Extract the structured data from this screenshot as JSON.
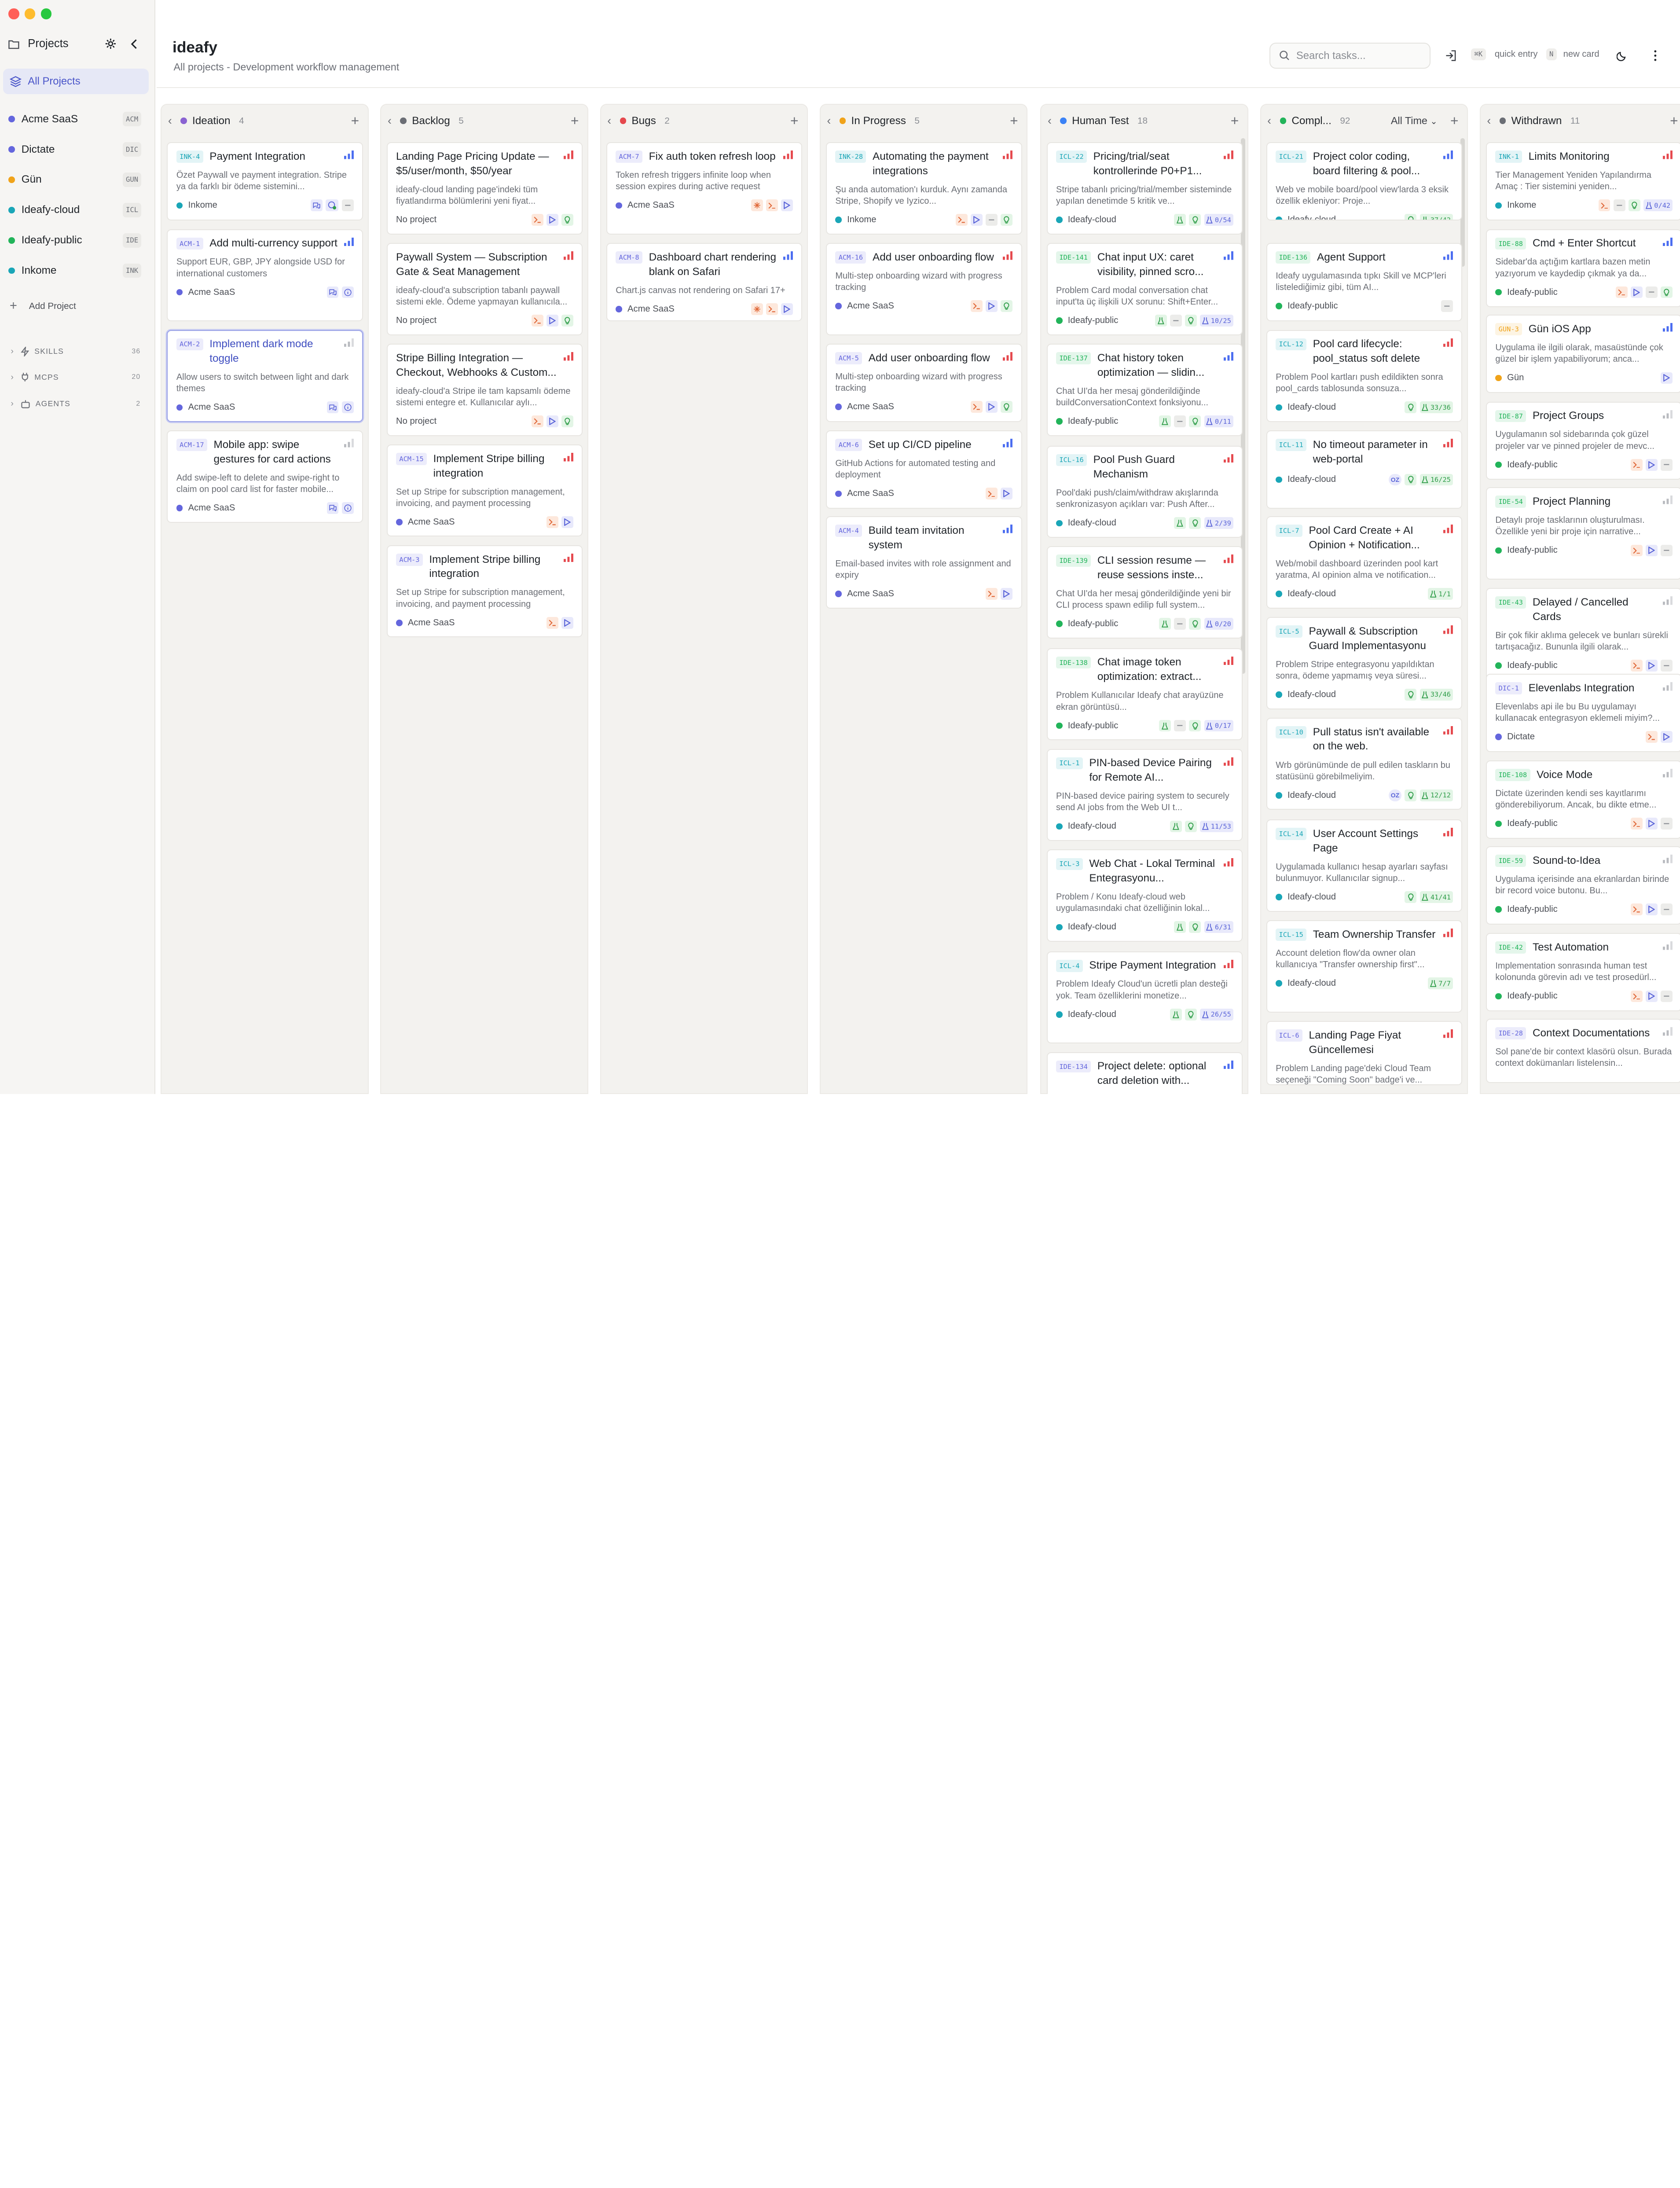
{
  "sidebar": {
    "title": "Projects",
    "all_projects": "All Projects",
    "projects": [
      {
        "name": "Acme SaaS",
        "code": "ACM",
        "color": "#6466dd"
      },
      {
        "name": "Dictate",
        "code": "DIC",
        "color": "#6466dd"
      },
      {
        "name": "Gün",
        "code": "GUN",
        "color": "#f0a31a"
      },
      {
        "name": "Ideafy-cloud",
        "code": "ICL",
        "color": "#1aa6b7"
      },
      {
        "name": "Ideafy-public",
        "code": "IDE",
        "color": "#22b45a"
      },
      {
        "name": "Inkome",
        "code": "INK",
        "color": "#1aa6b7"
      }
    ],
    "add_project": "Add Project",
    "sections": [
      {
        "label": "SKILLS",
        "count": "36"
      },
      {
        "label": "MCPS",
        "count": "20"
      },
      {
        "label": "AGENTS",
        "count": "2"
      }
    ]
  },
  "header": {
    "title": "ideafy",
    "subtitle": "All projects - Development workflow management",
    "search_placeholder": "Search tasks...",
    "kbd_quick": "⌘K",
    "quick_entry": "quick entry",
    "kbd_new": "N",
    "new_card": "new card"
  },
  "colors": {
    "accent": "#4a55c9",
    "ideation": "#8a63d2",
    "backlog": "#6b6e75",
    "bugs": "#e5484d",
    "in_progress": "#f0a31a",
    "human_test": "#3b82f6",
    "completed": "#22b45a",
    "withdrawn": "#6b6e75"
  },
  "columns": [
    {
      "name": "Ideation",
      "count": "4",
      "color": "#8a63d2",
      "cards": [
        {
          "id": "INK-4",
          "title": "Payment Integration",
          "desc": "Özet Paywall ve payment integration. Stripe ya da farklı bir ödeme sistemini...",
          "project": "Inkome",
          "pcolor": "#1aa6b7",
          "pri": "blue",
          "chips": [
            "chat",
            "gear-ok",
            "grey"
          ]
        },
        {
          "id": "ACM-1",
          "title": "Add multi-currency support",
          "desc": "Support EUR, GBP, JPY alongside USD for international customers",
          "project": "Acme SaaS",
          "pcolor": "#6466dd",
          "pri": "blue",
          "chips": [
            "chat",
            "info"
          ]
        },
        {
          "id": "ACM-2",
          "title": "Implement dark mode toggle",
          "desc": "Allow users to switch between light and dark themes",
          "project": "Acme SaaS",
          "pcolor": "#6466dd",
          "pri": "grey",
          "chips": [
            "chat",
            "info"
          ]
        },
        {
          "id": "ACM-17",
          "title": "Mobile app: swipe gestures for card actions",
          "desc": "Add swipe-left to delete and swipe-right to claim on pool card list for faster mobile...",
          "project": "Acme SaaS",
          "pcolor": "#6466dd",
          "pri": "grey",
          "chips": [
            "chat",
            "info"
          ]
        }
      ]
    },
    {
      "name": "Backlog",
      "count": "5",
      "color": "#6b6e75",
      "cards": [
        {
          "id": "",
          "title": "Landing Page Pricing Update — $5/user/month, $50/year",
          "desc": "ideafy-cloud landing page'indeki tüm fiyatlandırma bölümlerini yeni fiyat...",
          "project": "No project",
          "pcolor": "",
          "pri": "red",
          "chips": [
            "term",
            "play",
            "bulb"
          ]
        },
        {
          "id": "",
          "title": "Paywall System — Subscription Gate & Seat Management",
          "desc": "ideafy-cloud'a subscription tabanlı paywall sistemi ekle. Ödeme yapmayan kullanıcıla...",
          "project": "No project",
          "pcolor": "",
          "pri": "red",
          "chips": [
            "term",
            "play",
            "bulb"
          ]
        },
        {
          "id": "",
          "title": "Stripe Billing Integration — Checkout, Webhooks & Custom...",
          "desc": "ideafy-cloud'a Stripe ile tam kapsamlı ödeme sistemi entegre et. Kullanıcılar aylı...",
          "project": "No project",
          "pcolor": "",
          "pri": "red",
          "chips": [
            "term",
            "play",
            "bulb"
          ]
        },
        {
          "id": "ACM-15",
          "title": "Implement Stripe billing integration",
          "desc": "Set up Stripe for subscription management, invoicing, and payment processing",
          "project": "Acme SaaS",
          "pcolor": "#6466dd",
          "pri": "red",
          "chips": [
            "term",
            "play"
          ]
        },
        {
          "id": "ACM-3",
          "title": "Implement Stripe billing integration",
          "desc": "Set up Stripe for subscription management, invoicing, and payment processing",
          "project": "Acme SaaS",
          "pcolor": "#6466dd",
          "pri": "red",
          "chips": [
            "term",
            "play"
          ]
        }
      ]
    },
    {
      "name": "Bugs",
      "count": "2",
      "color": "#e5484d",
      "cards": [
        {
          "id": "ACM-7",
          "title": "Fix auth token refresh loop",
          "desc": "Token refresh triggers infinite loop when session expires during active request",
          "project": "Acme SaaS",
          "pcolor": "#6466dd",
          "pri": "red",
          "chips": [
            "bug",
            "term",
            "play"
          ]
        },
        {
          "id": "ACM-8",
          "title": "Dashboard chart rendering blank on Safari",
          "desc": "Chart.js canvas not rendering on Safari 17+",
          "project": "Acme SaaS",
          "pcolor": "#6466dd",
          "pri": "blue",
          "chips": [
            "bug",
            "term",
            "play"
          ]
        }
      ]
    },
    {
      "name": "In Progress",
      "count": "5",
      "color": "#f0a31a",
      "cards": [
        {
          "id": "INK-28",
          "title": "Automating the payment integrations",
          "desc": "Şu anda automation'ı kurduk. Aynı zamanda Stripe, Shopify ve Iyzico...",
          "project": "Inkome",
          "pcolor": "#1aa6b7",
          "pri": "red",
          "chips": [
            "term",
            "play",
            "grey",
            "bulb"
          ]
        },
        {
          "id": "ACM-16",
          "title": "Add user onboarding flow",
          "desc": "Multi-step onboarding wizard with progress tracking",
          "project": "Acme SaaS",
          "pcolor": "#6466dd",
          "pri": "red",
          "chips": [
            "term",
            "play",
            "bulb"
          ]
        },
        {
          "id": "ACM-5",
          "title": "Add user onboarding flow",
          "desc": "Multi-step onboarding wizard with progress tracking",
          "project": "Acme SaaS",
          "pcolor": "#6466dd",
          "pri": "red",
          "chips": [
            "term",
            "play",
            "bulb"
          ]
        },
        {
          "id": "ACM-6",
          "title": "Set up CI/CD pipeline",
          "desc": "GitHub Actions for automated testing and deployment",
          "project": "Acme SaaS",
          "pcolor": "#6466dd",
          "pri": "blue",
          "chips": [
            "term",
            "play"
          ]
        },
        {
          "id": "ACM-4",
          "title": "Build team invitation system",
          "desc": "Email-based invites with role assignment and expiry",
          "project": "Acme SaaS",
          "pcolor": "#6466dd",
          "pri": "blue",
          "chips": [
            "term",
            "play"
          ]
        }
      ]
    },
    {
      "name": "Human Test",
      "count": "18",
      "color": "#3b82f6",
      "cards": [
        {
          "id": "ICL-22",
          "title": "Pricing/trial/seat kontrollerinde P0+P1...",
          "desc": "Stripe tabanlı pricing/trial/member sisteminde yapılan denetimde 5 kritik ve...",
          "project": "Ideafy-cloud",
          "pcolor": "#1aa6b7",
          "pri": "red",
          "chips": [
            "flask",
            "bulb",
            "prog:0/54"
          ]
        },
        {
          "id": "IDE-141",
          "title": "Chat input UX: caret visibility, pinned scro...",
          "desc": "Problem Card modal conversation chat input'ta üç ilişkili UX sorunu: Shift+Enter...",
          "project": "Ideafy-public",
          "pcolor": "#22b45a",
          "pri": "blue",
          "chips": [
            "flask",
            "grey",
            "bulb",
            "prog:10/25"
          ]
        },
        {
          "id": "IDE-137",
          "title": "Chat history token optimization — slidin...",
          "desc": "Chat UI'da her mesaj gönderildiğinde buildConversationContext fonksiyonu...",
          "project": "Ideafy-public",
          "pcolor": "#22b45a",
          "pri": "blue",
          "chips": [
            "flask",
            "grey",
            "bulb",
            "prog:0/11"
          ]
        },
        {
          "id": "ICL-16",
          "title": "Pool Push Guard Mechanism",
          "desc": "Pool'daki push/claim/withdraw akışlarında senkronizasyon açıkları var: Push After...",
          "project": "Ideafy-cloud",
          "pcolor": "#1aa6b7",
          "pri": "red",
          "chips": [
            "flask",
            "bulb",
            "prog:2/39"
          ]
        },
        {
          "id": "IDE-139",
          "title": "CLI session resume — reuse sessions inste...",
          "desc": "Chat UI'da her mesaj gönderildiğinde yeni bir CLI process spawn edilip full system...",
          "project": "Ideafy-public",
          "pcolor": "#22b45a",
          "pri": "red",
          "chips": [
            "flask",
            "grey",
            "bulb",
            "prog:0/20"
          ]
        },
        {
          "id": "IDE-138",
          "title": "Chat image token optimization: extract...",
          "desc": "Problem Kullanıcılar Ideafy chat arayüzüne ekran görüntüsü...",
          "project": "Ideafy-public",
          "pcolor": "#22b45a",
          "pri": "red",
          "chips": [
            "flask",
            "grey",
            "bulb",
            "prog:0/17"
          ]
        },
        {
          "id": "ICL-1",
          "title": "PIN-based Device Pairing for Remote AI...",
          "desc": "PIN-based device pairing system to securely send AI jobs from the Web UI t...",
          "project": "Ideafy-cloud",
          "pcolor": "#1aa6b7",
          "pri": "red",
          "chips": [
            "flask",
            "bulb",
            "prog:11/53"
          ]
        },
        {
          "id": "ICL-3",
          "title": "Web Chat - Lokal Terminal Entegrasyonu...",
          "desc": "Problem / Konu Ideafy-cloud web uygulamasındaki chat özelliğinin lokal...",
          "project": "Ideafy-cloud",
          "pcolor": "#1aa6b7",
          "pri": "red",
          "chips": [
            "flask",
            "bulb",
            "prog:6/31"
          ]
        },
        {
          "id": "ICL-4",
          "title": "Stripe Payment Integration",
          "desc": "Problem Ideafy Cloud'un ücretli plan desteği yok. Team özelliklerini monetize...",
          "project": "Ideafy-cloud",
          "pcolor": "#1aa6b7",
          "pri": "red",
          "chips": [
            "flask",
            "bulb",
            "prog:26/55"
          ]
        },
        {
          "id": "IDE-134",
          "title": "Project delete: optional card deletion with...",
          "desc": "",
          "project": "",
          "pcolor": "",
          "pri": "blue",
          "chips": []
        }
      ]
    },
    {
      "name": "Compl...",
      "count": "92",
      "color": "#22b45a",
      "filter": "All Time",
      "cards": [
        {
          "id": "ICL-21",
          "title": "Project color coding, board filtering & pool...",
          "desc": "Web ve mobile board/pool view'larda 3 eksik özellik ekleniyor: Proje...",
          "project": "Ideafy-cloud",
          "pcolor": "#1aa6b7",
          "pri": "blue",
          "chips": [
            "bulb",
            "progg:37/42"
          ]
        },
        {
          "id": "IDE-136",
          "title": "Agent Support",
          "desc": "Ideafy uygulamasında tıpkı Skill ve MCP'leri listelediğimiz gibi, tüm AI...",
          "project": "Ideafy-public",
          "pcolor": "#22b45a",
          "pri": "blue",
          "chips": [
            "grey"
          ]
        },
        {
          "id": "ICL-12",
          "title": "Pool card lifecycle: pool_status soft delete",
          "desc": "Problem Pool kartları push edildikten sonra pool_cards tablosunda sonsuza...",
          "project": "Ideafy-cloud",
          "pcolor": "#1aa6b7",
          "pri": "red",
          "chips": [
            "bulb",
            "progg:33/36"
          ]
        },
        {
          "id": "ICL-11",
          "title": "No timeout parameter in web-portal",
          "desc": "",
          "project": "Ideafy-cloud",
          "pcolor": "#1aa6b7",
          "pri": "red",
          "chips": [
            "oz:OZ",
            "bulb",
            "progg:16/25"
          ]
        },
        {
          "id": "ICL-7",
          "title": "Pool Card Create + AI Opinion + Notification...",
          "desc": "Web/mobil dashboard üzerinden pool kart yaratma, AI opinion alma ve notification...",
          "project": "Ideafy-cloud",
          "pcolor": "#1aa6b7",
          "pri": "red",
          "chips": [
            "progg:1/1"
          ]
        },
        {
          "id": "ICL-5",
          "title": "Paywall & Subscription Guard Implementasyonu",
          "desc": "Problem Stripe entegrasyonu yapıldıktan sonra, ödeme yapmamış veya süresi...",
          "project": "Ideafy-cloud",
          "pcolor": "#1aa6b7",
          "pri": "red",
          "chips": [
            "bulb",
            "progg:33/46"
          ]
        },
        {
          "id": "ICL-10",
          "title": "Pull status isn't available on the web.",
          "desc": "Wrb görünümünde de pull edilen taskların bu statüsünü görebilmeliyim.",
          "project": "Ideafy-cloud",
          "pcolor": "#1aa6b7",
          "pri": "red",
          "chips": [
            "oz:OZ",
            "bulb",
            "progg:12/12"
          ]
        },
        {
          "id": "ICL-14",
          "title": "User Account Settings Page",
          "desc": "Uygulamada kullanıcı hesap ayarları sayfası bulunmuyor. Kullanıcılar signup...",
          "project": "Ideafy-cloud",
          "pcolor": "#1aa6b7",
          "pri": "red",
          "chips": [
            "bulb",
            "progg:41/41"
          ]
        },
        {
          "id": "ICL-15",
          "title": "Team Ownership Transfer",
          "desc": "Account deletion flow'da owner olan kullanıcıya \"Transfer ownership first\"...",
          "project": "Ideafy-cloud",
          "pcolor": "#1aa6b7",
          "pri": "red",
          "chips": [
            "progg:7/7"
          ]
        },
        {
          "id": "ICL-6",
          "title": "Landing Page Fiyat Güncellemesi",
          "desc": "Problem Landing page'deki Cloud Team seçeneği \"Coming Soon\" badge'i ve...",
          "project": "",
          "pcolor": "",
          "pri": "red",
          "chips": []
        }
      ]
    },
    {
      "name": "Withdrawn",
      "count": "11",
      "color": "#6b6e75",
      "cards": [
        {
          "id": "INK-1",
          "title": "Limits Monitoring",
          "desc": "Tier Management Yeniden Yapılandırma Amaç : Tier sistemini yeniden...",
          "project": "Inkome",
          "pcolor": "#1aa6b7",
          "pri": "red",
          "chips": [
            "term",
            "grey",
            "bulb",
            "prog:0/42"
          ]
        },
        {
          "id": "IDE-88",
          "title": "Cmd + Enter Shortcut",
          "desc": "Sidebar'da açtığım kartlara bazen metin yazıyorum ve kaydedip çıkmak ya da...",
          "project": "Ideafy-public",
          "pcolor": "#22b45a",
          "pri": "blue",
          "chips": [
            "term",
            "play",
            "grey",
            "bulb"
          ]
        },
        {
          "id": "GUN-3",
          "title": "Gün iOS App",
          "desc": "Uygulama ile ilgili olarak, masaüstünde çok güzel bir işlem yapabiliyorum; anca...",
          "project": "Gün",
          "pcolor": "#f0a31a",
          "pri": "blue",
          "chips": [
            "play"
          ]
        },
        {
          "id": "IDE-87",
          "title": "Project Groups",
          "desc": "Uygulamanın sol sidebarında çok güzel projeler var ve pinned projeler de mevc...",
          "project": "Ideafy-public",
          "pcolor": "#22b45a",
          "pri": "grey",
          "chips": [
            "term",
            "play",
            "grey"
          ]
        },
        {
          "id": "IDE-54",
          "title": "Project Planning",
          "desc": "Detaylı proje tasklarının oluşturulması. Özellikle yeni bir proje için narrative...",
          "project": "Ideafy-public",
          "pcolor": "#22b45a",
          "pri": "grey",
          "chips": [
            "term",
            "play",
            "grey"
          ]
        },
        {
          "id": "IDE-43",
          "title": "Delayed / Cancelled Cards",
          "desc": "Bir çok fikir aklıma gelecek ve bunları sürekli tartışacağız. Bununla ilgili olarak...",
          "project": "Ideafy-public",
          "pcolor": "#22b45a",
          "pri": "grey",
          "chips": [
            "term",
            "play",
            "grey"
          ]
        },
        {
          "id": "DIC-1",
          "title": "Elevenlabs Integration",
          "desc": "Elevenlabs api ile bu Bu uygulamayı kullanacak entegrasyon eklemeli miyim?...",
          "project": "Dictate",
          "pcolor": "#6466dd",
          "pri": "grey",
          "chips": [
            "term",
            "play"
          ]
        },
        {
          "id": "IDE-108",
          "title": "Voice Mode",
          "desc": "Dictate üzerinden kendi ses kayıtlarımı gönderebiliyorum. Ancak, bu dikte etme...",
          "project": "Ideafy-public",
          "pcolor": "#22b45a",
          "pri": "grey",
          "chips": [
            "term",
            "play",
            "grey"
          ]
        },
        {
          "id": "IDE-59",
          "title": "Sound-to-Idea",
          "desc": "Uygulama içerisinde ana ekranlardan birinde bir record voice butonu. Bu...",
          "project": "Ideafy-public",
          "pcolor": "#22b45a",
          "pri": "grey",
          "chips": [
            "term",
            "play",
            "grey"
          ]
        },
        {
          "id": "IDE-42",
          "title": "Test Automation",
          "desc": "Implementation sonrasında human test kolonunda görevin adı ve test prosedürl...",
          "project": "Ideafy-public",
          "pcolor": "#22b45a",
          "pri": "grey",
          "chips": [
            "term",
            "play",
            "grey"
          ]
        },
        {
          "id": "IDE-28",
          "title": "Context Documentations",
          "desc": "Sol pane'de bir context klasörü olsun. Burada context dokümanları listelensin...",
          "project": "",
          "pcolor": "",
          "pri": "grey",
          "chips": []
        }
      ]
    }
  ]
}
